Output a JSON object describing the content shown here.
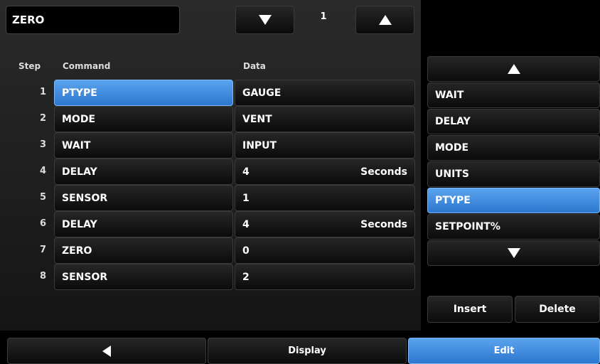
{
  "title": "ZERO",
  "step_counter": "1",
  "headers": {
    "step": "Step",
    "command": "Command",
    "data": "Data"
  },
  "rows": [
    {
      "step": "1",
      "command": "PTYPE",
      "data": "GAUGE",
      "unit": ""
    },
    {
      "step": "2",
      "command": "MODE",
      "data": "VENT",
      "unit": ""
    },
    {
      "step": "3",
      "command": "WAIT",
      "data": "INPUT",
      "unit": ""
    },
    {
      "step": "4",
      "command": "DELAY",
      "data": "4",
      "unit": "Seconds"
    },
    {
      "step": "5",
      "command": "SENSOR",
      "data": "1",
      "unit": ""
    },
    {
      "step": "6",
      "command": "DELAY",
      "data": "4",
      "unit": "Seconds"
    },
    {
      "step": "7",
      "command": "ZERO",
      "data": "0",
      "unit": ""
    },
    {
      "step": "8",
      "command": "SENSOR",
      "data": "2",
      "unit": ""
    }
  ],
  "command_list": [
    "WAIT",
    "DELAY",
    "MODE",
    "UNITS",
    "PTYPE",
    "SETPOINT%"
  ],
  "actions": {
    "insert": "Insert",
    "delete": "Delete"
  },
  "bottom_nav": {
    "display": "Display",
    "edit": "Edit"
  },
  "colors": {
    "selected": "#3d8be0",
    "background": "#000000"
  }
}
